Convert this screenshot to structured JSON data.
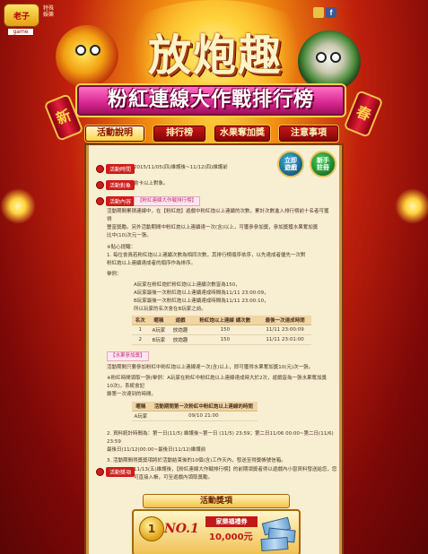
{
  "header": {
    "logo_text": "老子",
    "logo_sub": "game",
    "logo_side": [
      "特殊",
      "娛樂"
    ],
    "title": "放炮趣",
    "banner": "粉紅連線大作戰排行榜",
    "firecracker_left": "新",
    "firecracker_right": "春",
    "social": [
      "plurk-icon",
      "facebook-icon"
    ],
    "facebook_glyph": "f"
  },
  "nav": {
    "tabs": [
      {
        "label": "活動說明",
        "active": true
      },
      {
        "label": "排行榜",
        "active": false
      },
      {
        "label": "水果奪加獎",
        "active": false
      },
      {
        "label": "注意事項",
        "active": false
      }
    ]
  },
  "panel": {
    "play_button": "立即\n遊戲",
    "register_button": "新手\n註冊",
    "sections": {
      "time": {
        "label": "活動時間",
        "text": "2015/11/05(四)維護後~11/12(四)維護前"
      },
      "target": {
        "label": "活動對象",
        "text": "會卡以上對象。"
      },
      "content": {
        "label": "活動內容",
        "subtitle": "【粉紅連線大作戰排行榜】"
      },
      "prize": {
        "label": "活動獎項"
      }
    },
    "content_lines": [
      "活動期間累積連線中，在【粉紅炮】遊戲中粉紅炮以上連續的次數，累計次數進入排行榜前十名者可獲得",
      "豐富獎勵。另外活動期間中粉紅炮以上連續達一次(含)以上，可獲參參加獎，參加獎獲水果奪加獎",
      "比中(10)次元一張。",
      "※貼心提醒：",
      "1.   每位會員若粉紅炮以上連續次數為相同次數，其排行榜順序依序，以先達成者優先一次對",
      "      粉紅炮以上連續達成者的順序作為排序。",
      "舉例：",
      "A玩家在粉紅炮於粉紅炮以上連續次數皆為150，",
      "A玩家最後一次粉紅炮以上連續達成時間為11/11 23:00:09，",
      "B玩家最後一次粉紅炮以上連續達成時間為11/11 23:00:10，",
      "所以玩家的名次會在B玩家之前。"
    ],
    "table1": {
      "headers": [
        "名次",
        "暱稱",
        "遊戲",
        "粉紅炮以上連線 總次數",
        "最後一次達成時間"
      ],
      "rows": [
        [
          "1",
          "A玩家",
          "放炮趣",
          "150",
          "11/11 23:00:09"
        ],
        [
          "2",
          "B玩家",
          "放炮趣",
          "150",
          "11/11 23:01:00"
        ]
      ]
    },
    "extra_subtitle": "【水果參加獎】",
    "extra_lines": [
      "活動期間只要參加粉紅中粉紅炮以上連線達一次(含)以上，即可獲得水果奪加獎10(元)次一張。",
      "※粉紅時間領取一張(舉例：A玩家在粉紅中粉紅炮以上連線達成時大於2次，遊戲皆為一張水果奪加獎10次)，系統會記",
      "錄第一次達到的時間。"
    ],
    "table2": {
      "headers": [
        "暱稱",
        "活動期間第一次粉紅中粉紅炮以上連線的時間"
      ],
      "rows": [
        [
          "A玩家",
          "09/10 21:00"
        ]
      ]
    },
    "footer_lines": [
      "2.   資料統計時間為：第一日(11/5) 維護後~第一日 (11/5) 23:59；第二日11/06 00:00~第二日(11/6) 23:59",
      "      最後日(11/12)00:00~最後日(11/12)維護前",
      "3.   活動期間得獎獎項將於活動結束後的10個(含)工作天內，發送至得獎帳號信箱。"
    ],
    "prize_intro": "11/13(五)維護後，【粉紅連線大作戰排行榜】的前期領獎者得以遊戲內小窗資料發送給您，您可直接入帳，可至遊戲內領取獎勵。",
    "prize_title": "活動獎項",
    "prize_card": {
      "medal": "1",
      "rank": "NO.1",
      "name": "家樂福禮券",
      "amount": "10,000元"
    }
  },
  "colors": {
    "accent_red": "#d01a1a",
    "gold": "#f1c14a",
    "panel_bg": "#f8eed2",
    "banner_pink": "#d7268e"
  }
}
